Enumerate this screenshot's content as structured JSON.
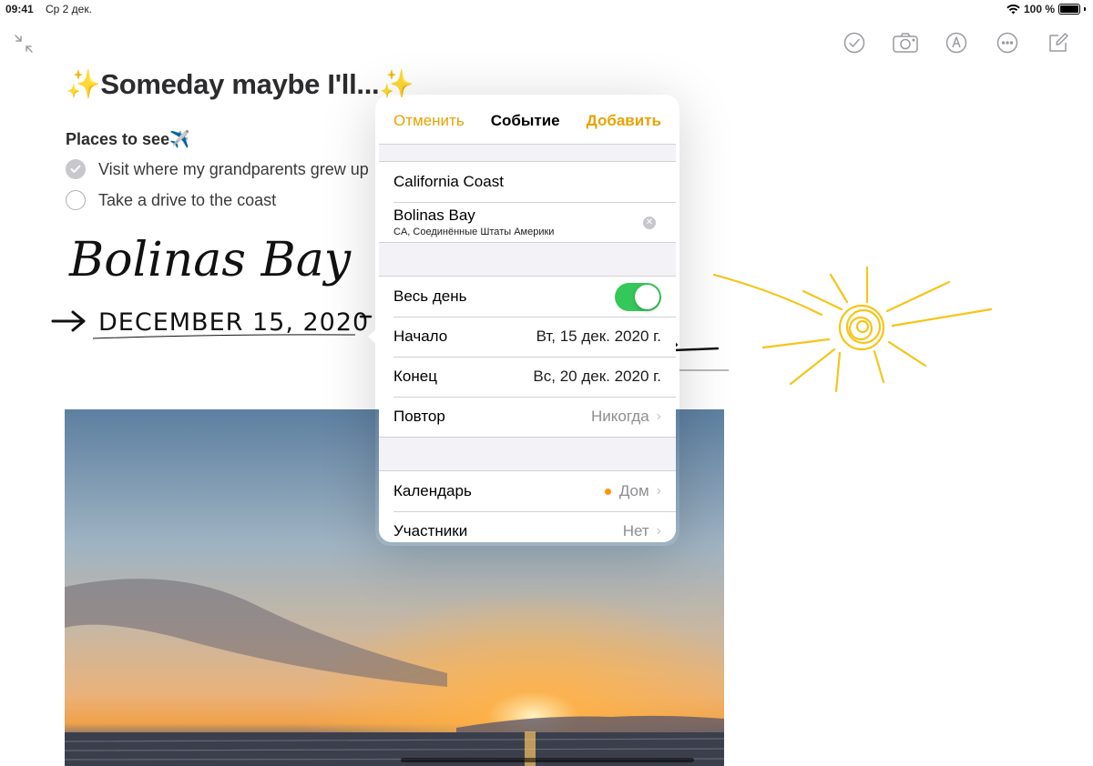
{
  "status_bar": {
    "time": "09:41",
    "date": "Ср 2 дек.",
    "battery": "100 %"
  },
  "toolbar": {
    "icons": [
      "collapse-icon",
      "checklist-icon",
      "camera-icon",
      "markup-icon",
      "more-icon",
      "compose-icon"
    ]
  },
  "note": {
    "title_prefix": "✨",
    "title": "Someday maybe I'll...",
    "title_suffix": "✨",
    "subheading": "Places to see✈️",
    "checklist": [
      {
        "text": "Visit where my grandparents grew up",
        "checked": true
      },
      {
        "text": "Take a drive to the coast",
        "checked": false
      }
    ],
    "handwriting_line1": "Bolinas Bay",
    "handwriting_line2": "DECEMBER 15, 2020"
  },
  "event_popover": {
    "cancel": "Отменить",
    "title": "Событие",
    "add": "Добавить",
    "event_title": "California Coast",
    "location_name": "Bolinas Bay",
    "location_detail": "CA, Соединённые Штаты Америки",
    "all_day_label": "Весь день",
    "all_day": true,
    "start_label": "Начало",
    "start_value": "Вт, 15 дек. 2020 г.",
    "end_label": "Конец",
    "end_value": "Вс, 20 дек. 2020 г.",
    "repeat_label": "Повтор",
    "repeat_value": "Никогда",
    "calendar_label": "Календарь",
    "calendar_value": "Дом",
    "calendar_color": "#ff9500",
    "invitees_label": "Участники",
    "invitees_value": "Нет"
  },
  "colors": {
    "accent": "#e8a200",
    "toggle_on": "#34c759",
    "sun": "#f5c518"
  }
}
